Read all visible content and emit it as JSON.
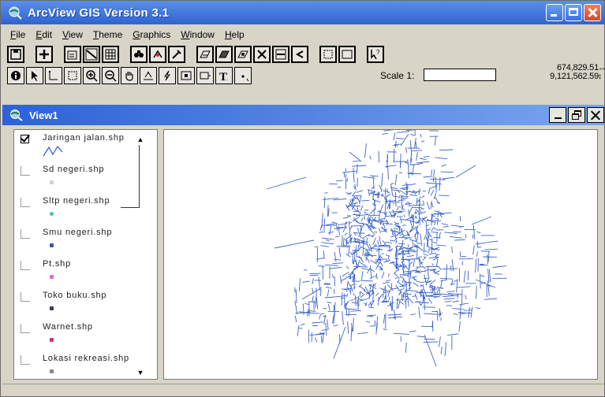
{
  "app": {
    "title": "ArcView GIS Version 3.1"
  },
  "menubar": {
    "items": [
      {
        "label": "File",
        "u": "F",
        "rest": "ile"
      },
      {
        "label": "Edit",
        "u": "E",
        "rest": "dit"
      },
      {
        "label": "View",
        "u": "V",
        "rest": "iew"
      },
      {
        "label": "Theme",
        "u": "T",
        "rest": "heme"
      },
      {
        "label": "Graphics",
        "u": "G",
        "rest": "raphics"
      },
      {
        "label": "Window",
        "u": "W",
        "rest": "indow"
      },
      {
        "label": "Help",
        "u": "H",
        "rest": "elp"
      }
    ]
  },
  "toolbar2": {
    "scale_label": "Scale 1:",
    "scale_value": "",
    "coord_x": "674,829.51",
    "coord_y": "9,121,562.59"
  },
  "view": {
    "title": "View1"
  },
  "toc": {
    "layers": [
      {
        "name": "Jaringan jalan.shp",
        "checked": true,
        "symbol": "line",
        "color": "#2b55c6"
      },
      {
        "name": "Sd negeri.shp",
        "checked": false,
        "symbol": "point",
        "color": "#d0d0d0"
      },
      {
        "name": "Sltp negeri.shp",
        "checked": false,
        "symbol": "point",
        "color": "#4fb9c8"
      },
      {
        "name": "Smu negeri.shp",
        "checked": false,
        "symbol": "point",
        "color": "#3c56a8"
      },
      {
        "name": "Pt.shp",
        "checked": false,
        "symbol": "point",
        "color": "#d86fd0"
      },
      {
        "name": "Toko buku.shp",
        "checked": false,
        "symbol": "point",
        "color": "#3a3a6a"
      },
      {
        "name": "Warnet.shp",
        "checked": false,
        "symbol": "point",
        "color": "#c8327a"
      },
      {
        "name": "Lokasi rekreasi.shp",
        "checked": false,
        "symbol": "point",
        "color": "#888888"
      }
    ]
  },
  "map": {
    "road_color": "#3a62c8"
  }
}
